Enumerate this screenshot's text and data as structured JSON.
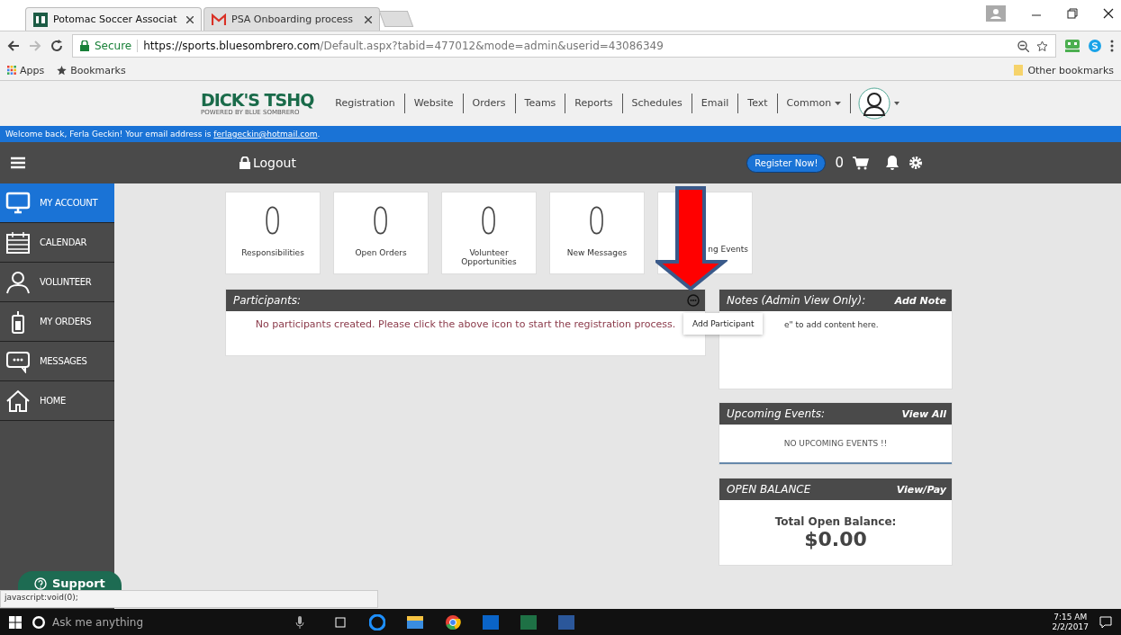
{
  "browser": {
    "tabs": [
      {
        "label": "Potomac Soccer Associat",
        "selected": true,
        "kind": "hq"
      },
      {
        "label": "PSA Onboarding process",
        "selected": false,
        "kind": "mail"
      }
    ],
    "address": {
      "secure_label": "Secure",
      "host": "https://sports.bluesombrero.com",
      "path": "/Default.aspx?tabid=477012&mode=admin&userid=43086349"
    },
    "bookmarks": [
      "Apps",
      "Bookmarks"
    ],
    "other_bookmarks": "Other bookmarks"
  },
  "header": {
    "logo_main": "DICK'S TSHQ",
    "logo_sub": "POWERED BY BLUE SOMBRERO",
    "nav": [
      {
        "label": "Registration",
        "dropdown": false
      },
      {
        "label": "Website",
        "dropdown": false
      },
      {
        "label": "Orders",
        "dropdown": false
      },
      {
        "label": "Teams",
        "dropdown": false
      },
      {
        "label": "Reports",
        "dropdown": false
      },
      {
        "label": "Schedules",
        "dropdown": false
      },
      {
        "label": "Email",
        "dropdown": false
      },
      {
        "label": "Text",
        "dropdown": false
      },
      {
        "label": "Common",
        "dropdown": true
      }
    ]
  },
  "welcome": {
    "text": "Welcome back, Ferla Geckin! Your email address is",
    "email": "ferlageckin@hotmail.com",
    "end": "."
  },
  "toolbar": {
    "logout": "Logout",
    "register": "Register Now!",
    "cart_count": "0"
  },
  "sidebar": {
    "items": [
      {
        "label": "MY ACCOUNT",
        "kind": "monitor",
        "selected": true
      },
      {
        "label": "CALENDAR",
        "kind": "calendar",
        "selected": false
      },
      {
        "label": "VOLUNTEER",
        "kind": "person",
        "selected": false
      },
      {
        "label": "MY ORDERS",
        "kind": "bottle",
        "selected": false
      },
      {
        "label": "MESSAGES",
        "kind": "chat",
        "selected": false
      },
      {
        "label": "HOME",
        "kind": "home",
        "selected": false
      }
    ]
  },
  "tiles": [
    {
      "count": "0",
      "label": "Responsibilities"
    },
    {
      "count": "0",
      "label": "Open Orders"
    },
    {
      "count": "0",
      "label": "Volunteer Opportunities"
    },
    {
      "count": "0",
      "label": "New Messages"
    },
    {
      "label": "ng Events"
    }
  ],
  "participants": {
    "title": "Participants:",
    "message": "No participants created. Please click the above icon to start the registration process.",
    "menu_item": "Add Participant"
  },
  "notes": {
    "title": "Notes (Admin View Only):",
    "action": "Add Note",
    "body": "e\" to add content here."
  },
  "upcoming": {
    "title": "Upcoming Events:",
    "action": "View All",
    "body": "NO UPCOMING EVENTS !!"
  },
  "balance": {
    "title": "OPEN BALANCE",
    "action": "View/Pay",
    "label": "Total Open Balance:",
    "amount": "$0.00"
  },
  "support": "Support",
  "status_url": "javascript:void(0);",
  "taskbar": {
    "search": "Ask me anything",
    "time": "7:15 AM",
    "date": "2/2/2017"
  }
}
